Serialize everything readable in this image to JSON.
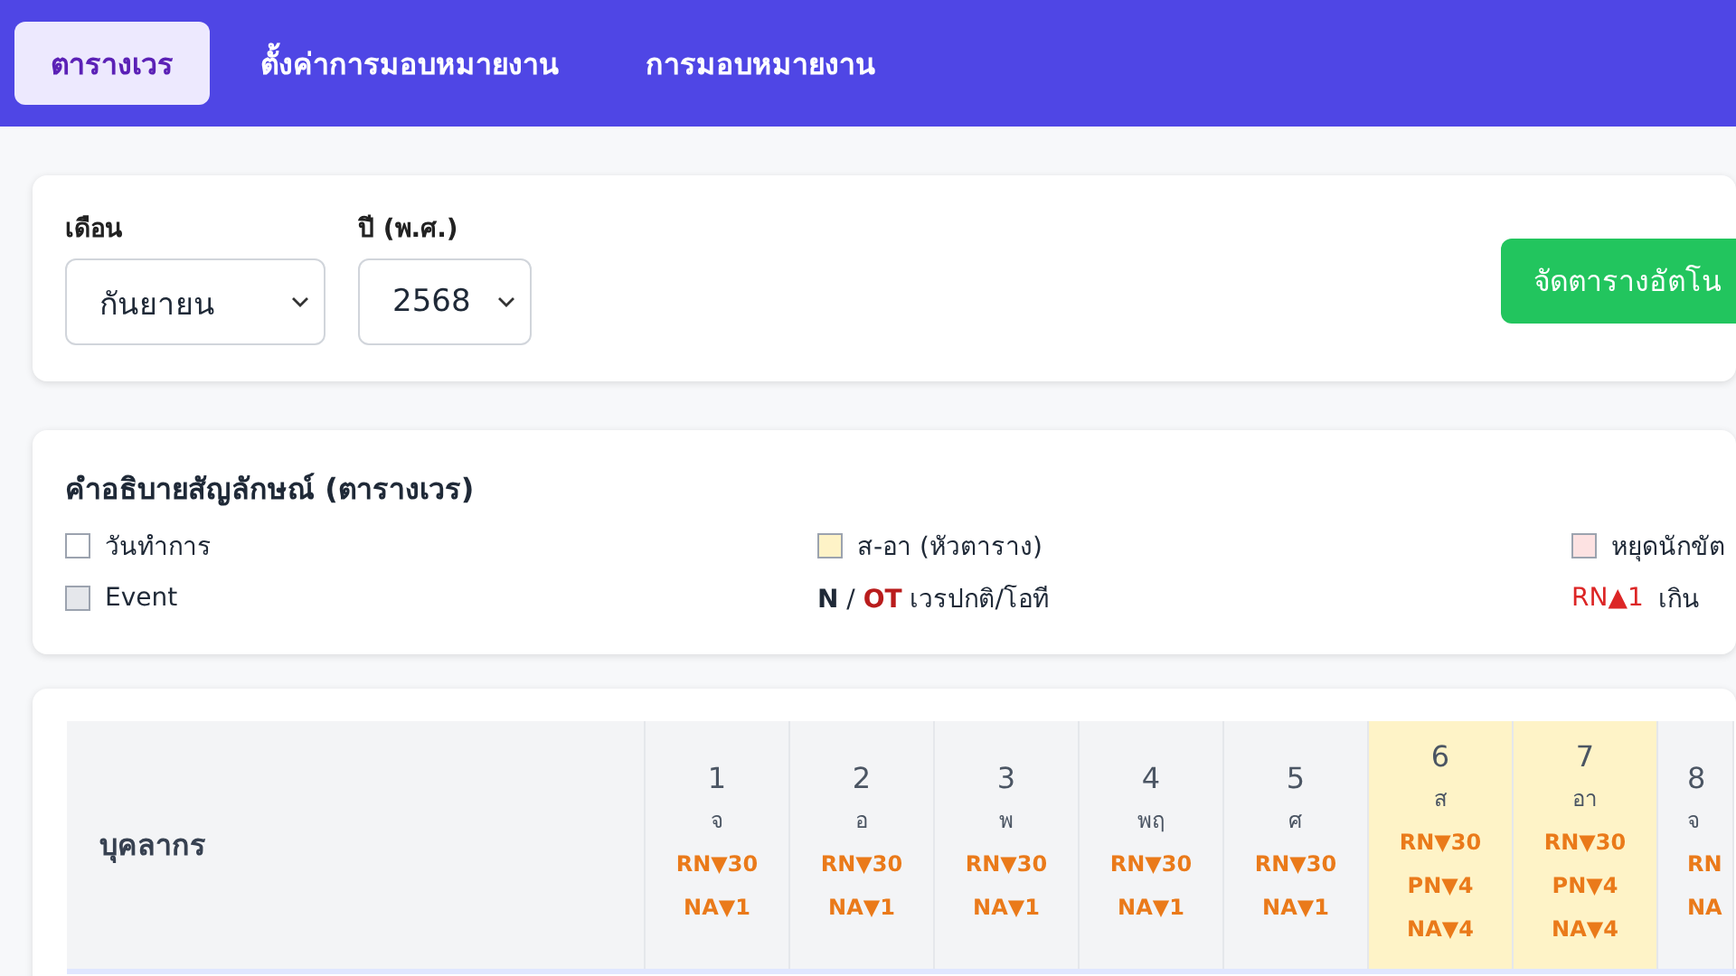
{
  "nav": {
    "tabs": [
      {
        "label": "ตารางเวร",
        "selected": true
      },
      {
        "label": "ตั้งค่าการมอบหมายงาน",
        "selected": false
      },
      {
        "label": "การมอบหมายงาน",
        "selected": false
      }
    ]
  },
  "filters": {
    "month": {
      "label": "เดือน",
      "value": "กันยายน"
    },
    "year": {
      "label": "ปี (พ.ศ.)",
      "value": "2568"
    },
    "auto_button": "จัดตารางอัตโน"
  },
  "legend": {
    "title": "คำอธิบายสัญลักษณ์ (ตารางเวร)",
    "items": [
      {
        "kind": "swatch",
        "color": "#ffffff",
        "label": "วันทำการ"
      },
      {
        "kind": "swatch",
        "color": "#fef3c7",
        "label": "ส-อา (หัวตาราง)"
      },
      {
        "kind": "swatch",
        "color": "#fde2e2",
        "label": "หยุดนักขัต"
      },
      {
        "kind": "swatch",
        "color": "#e5e7eb",
        "label": "Event"
      },
      {
        "kind": "shift",
        "normal": "N",
        "sep": "/",
        "ot": "OT",
        "label": "เวรปกติ/โอที"
      },
      {
        "kind": "over",
        "code": "RN▲1",
        "label": "เกิน"
      }
    ]
  },
  "table": {
    "name_header": "บุคลากร",
    "days": [
      {
        "day": "1",
        "dow": "จ",
        "weekend": false,
        "counts": [
          "RN▼30",
          "NA▼1"
        ]
      },
      {
        "day": "2",
        "dow": "อ",
        "weekend": false,
        "counts": [
          "RN▼30",
          "NA▼1"
        ]
      },
      {
        "day": "3",
        "dow": "พ",
        "weekend": false,
        "counts": [
          "RN▼30",
          "NA▼1"
        ]
      },
      {
        "day": "4",
        "dow": "พฤ",
        "weekend": false,
        "counts": [
          "RN▼30",
          "NA▼1"
        ]
      },
      {
        "day": "5",
        "dow": "ศ",
        "weekend": false,
        "counts": [
          "RN▼30",
          "NA▼1"
        ]
      },
      {
        "day": "6",
        "dow": "ส",
        "weekend": true,
        "counts": [
          "RN▼30",
          "PN▼4",
          "NA▼4"
        ]
      },
      {
        "day": "7",
        "dow": "อา",
        "weekend": true,
        "counts": [
          "RN▼30",
          "PN▼4",
          "NA▼4"
        ]
      },
      {
        "day": "8",
        "dow": "จ",
        "weekend": false,
        "counts": [
          "RN",
          "NA"
        ]
      }
    ]
  }
}
